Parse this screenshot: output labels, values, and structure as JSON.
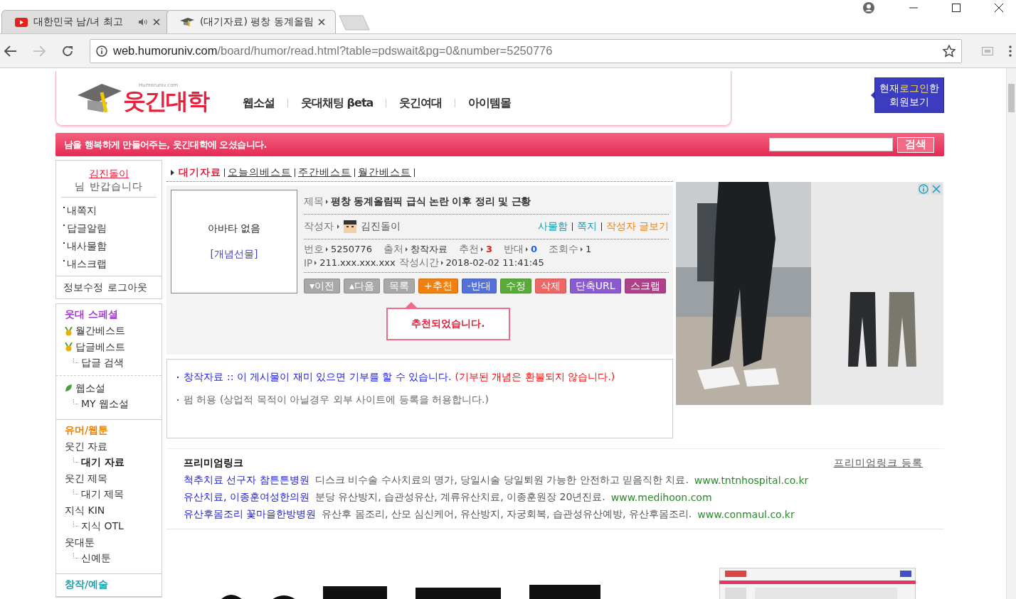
{
  "browser": {
    "tabs": [
      {
        "title": "대한민국 남/녀 최고",
        "selected": false,
        "kind": "video"
      },
      {
        "title": "(대기자료) 평창 동계올림",
        "selected": true,
        "kind": "site"
      }
    ],
    "url_host": "web.humoruniv.com",
    "url_path": "/board/humor/read.html?table=pdswait&pg=0&number=5250776"
  },
  "header": {
    "logo": "웃긴대학",
    "logo_sub": "Humoruniv.com",
    "nav": [
      "웹소설",
      "웃대채팅 βeta",
      "웃긴여대",
      "아이템몰"
    ],
    "login_button": {
      "before": "현재",
      "highlight": "로그인",
      "after": "한",
      "line2": "회원보기"
    }
  },
  "welcome": "남을 행복하게 만들어주는, 웃긴대학에 오셨습니다.",
  "search": {
    "button": "검색"
  },
  "sidebar": {
    "user": {
      "name": "김진돌이",
      "greeting": "님 반갑습니다",
      "menu": [
        "내쪽지",
        "답글알림",
        "내사물함",
        "내스크랩"
      ],
      "account": [
        "정보수정",
        "로그아웃"
      ]
    },
    "sections": [
      {
        "title": "웃대 스페셜",
        "color": "#a040c8",
        "groups": [
          [
            {
              "label": "월간베스트",
              "kind": "medal",
              "selected": false
            },
            {
              "label": "답글베스트",
              "kind": "medal",
              "selected": false
            },
            {
              "label": "답글 검색",
              "kind": "sub",
              "selected": false
            }
          ],
          [
            {
              "label": "웹소설",
              "kind": "leaf",
              "selected": false
            },
            {
              "label": "MY 웹소설",
              "kind": "sub",
              "selected": false
            }
          ]
        ]
      },
      {
        "title": "유머/웹툰",
        "color": "#e8820c",
        "groups": [
          [
            {
              "label": "웃긴 자료",
              "kind": "plain",
              "selected": false
            },
            {
              "label": "대기 자료",
              "kind": "sub",
              "selected": true
            },
            {
              "label": "웃긴 제목",
              "kind": "plain",
              "selected": false
            },
            {
              "label": "대기 제목",
              "kind": "sub",
              "selected": false
            },
            {
              "label": "지식 KIN",
              "kind": "plain",
              "selected": false
            },
            {
              "label": "지식 OTL",
              "kind": "sub",
              "selected": false
            },
            {
              "label": "웃대툰",
              "kind": "plain",
              "selected": false
            },
            {
              "label": "신예툰",
              "kind": "sub",
              "selected": false
            }
          ]
        ]
      },
      {
        "title": "창작/예술",
        "color": "#1f9fb0"
      }
    ]
  },
  "breadcrumb": [
    {
      "label": "대기자료",
      "selected": true
    },
    {
      "label": "오늘의베스트",
      "selected": false
    },
    {
      "label": "주간베스트",
      "selected": false
    },
    {
      "label": "월간베스트",
      "selected": false
    }
  ],
  "post": {
    "avatar": "아바타 없음",
    "gift": "[개념선물]",
    "title_label": "제목",
    "title": "평창 동계올림픽 급식 논란 이후 정리 및 근황",
    "author_label": "작성자",
    "author": "김진돌이",
    "author_links": [
      {
        "label": "사물함",
        "color": "#1a9cb0"
      },
      {
        "label": "쪽지",
        "color": "#1a9cb0"
      },
      {
        "label": "작성자 글보기",
        "color": "#f08010"
      }
    ],
    "meta": [
      {
        "label": "번호",
        "value": "5250776",
        "color": "#333333"
      },
      {
        "label": "출처",
        "value": "창작자료",
        "color": "#333333"
      },
      {
        "label": "추천",
        "value": "3",
        "color": "#e02020"
      },
      {
        "label": "반대",
        "value": "0",
        "color": "#2060e0"
      },
      {
        "label": "조회수",
        "value": "1",
        "color": "#333333"
      }
    ],
    "meta2": [
      {
        "label": "IP",
        "value": "211.xxx.xxx.xxx"
      },
      {
        "label": "작성시간",
        "value": "2018-02-02 11:41:45"
      }
    ],
    "buttons": [
      {
        "label": "▾이전",
        "color": "#a8a8a8"
      },
      {
        "label": "▴다음",
        "color": "#a8a8a8"
      },
      {
        "label": "목록",
        "color": "#a8a8a8"
      },
      {
        "label": "+추천",
        "color": "#f08010"
      },
      {
        "label": "-반대",
        "color": "#5570d8"
      },
      {
        "label": "수정",
        "color": "#5aaa3a"
      },
      {
        "label": "삭제",
        "color": "#ee6666"
      },
      {
        "label": "단축URL",
        "color": "#8a5ad0"
      },
      {
        "label": "스크랩",
        "color": "#b0408a"
      }
    ],
    "tooltip": "추천되었습니다."
  },
  "notice": {
    "lines": [
      [
        {
          "text": "창작자료",
          "color": "#2020e0"
        },
        {
          "text": ":: 이 게시물이 재미 있으면 기부를 할 수 있습니다.",
          "color": "#2020e0"
        },
        {
          "text": "(기부된 개념은 환불되지 않습니다.)",
          "color": "#ee1010"
        }
      ],
      [
        {
          "text": "펌 허용 (상업적 목적이 아닐경우 외부 사이트에 등록을 허용합니다.)",
          "color": "#666666"
        }
      ]
    ]
  },
  "premium": {
    "title": "프리미엄링크",
    "register": "프리미엄링크 등록",
    "links": [
      {
        "name": "척추치료 선구자 참튼튼병원",
        "desc": "디스크 비수술 수사치료의 명가, 당일시술 당일퇴원 가능한 안전하고 믿음직한 치료.",
        "url": "www.tntnhospital.co.kr"
      },
      {
        "name": "유산치료, 이종훈여성한의원",
        "desc": "분당 유산방지, 습관성유산, 계류유산치료, 이종훈원장 20년진료.",
        "url": "www.medihoon.com"
      },
      {
        "name": "유산후몸조리 꽃마을한방병원",
        "desc": "유산후 몸조리, 산모 심신케어, 유산방지, 자궁회복, 습관성유산예방, 유산후몸조리.",
        "url": "www.conmaul.co.kr"
      }
    ]
  }
}
